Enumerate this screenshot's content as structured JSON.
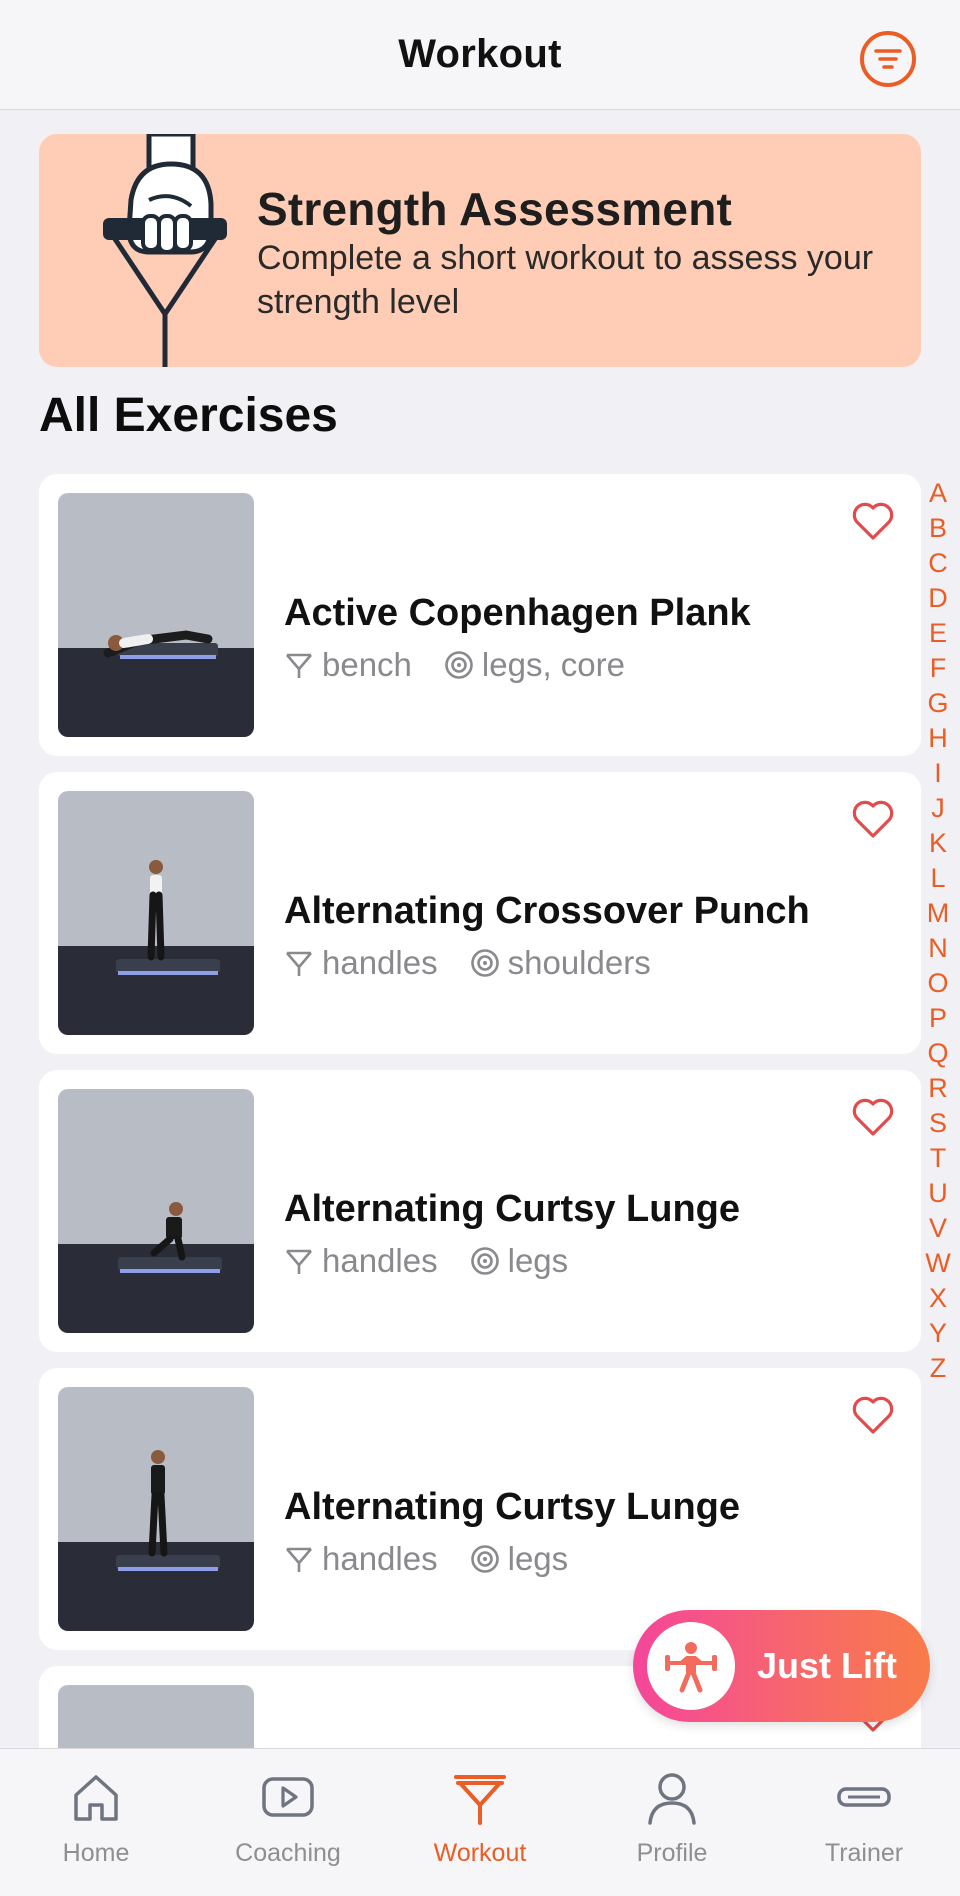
{
  "header": {
    "title": "Workout",
    "filter_icon": "filter-icon"
  },
  "banner": {
    "title": "Strength Assessment",
    "description": "Complete a short workout to assess your strength level",
    "icon": "hand-grip-handle-icon",
    "background": "#ffcdb6"
  },
  "section_title": "All Exercises",
  "exercises": [
    {
      "name": "Active Copenhagen Plank",
      "equipment": "bench",
      "targets": "legs, core",
      "favorite": false
    },
    {
      "name": "Alternating Crossover Punch",
      "equipment": "handles",
      "targets": "shoulders",
      "favorite": false
    },
    {
      "name": "Alternating Curtsy Lunge",
      "equipment": "handles",
      "targets": "legs",
      "favorite": false
    },
    {
      "name": "Alternating Curtsy Lunge",
      "equipment": "handles",
      "targets": "legs",
      "favorite": false
    }
  ],
  "alphabet": [
    "A",
    "B",
    "C",
    "D",
    "E",
    "F",
    "G",
    "H",
    "I",
    "J",
    "K",
    "L",
    "M",
    "N",
    "O",
    "P",
    "Q",
    "R",
    "S",
    "T",
    "U",
    "V",
    "W",
    "X",
    "Y",
    "Z"
  ],
  "just_lift": {
    "label": "Just Lift",
    "icon": "weightlifter-icon"
  },
  "tabs": [
    {
      "label": "Home",
      "icon": "home-icon",
      "active": false
    },
    {
      "label": "Coaching",
      "icon": "play-icon",
      "active": false
    },
    {
      "label": "Workout",
      "icon": "workout-handle-icon",
      "active": true
    },
    {
      "label": "Profile",
      "icon": "person-icon",
      "active": false
    },
    {
      "label": "Trainer",
      "icon": "trainer-device-icon",
      "active": false
    }
  ],
  "colors": {
    "accent": "#ea5d24",
    "heart": "#e24b4b",
    "meta_text": "#8a8a8e",
    "background": "#f1f0f5"
  }
}
